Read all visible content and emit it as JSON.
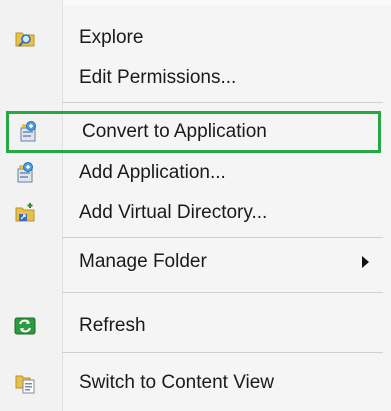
{
  "context_menu": {
    "items": [
      {
        "label": "Explore",
        "icon": "folder-search-icon"
      },
      {
        "label": "Edit Permissions...",
        "icon": ""
      },
      {
        "label": "Convert to Application",
        "icon": "convert-application-icon",
        "highlighted": true
      },
      {
        "label": "Add Application...",
        "icon": "add-application-icon"
      },
      {
        "label": "Add Virtual Directory...",
        "icon": "add-virtual-directory-icon"
      },
      {
        "label": "Manage Folder",
        "icon": "",
        "has_submenu": true
      },
      {
        "label": "Refresh",
        "icon": "refresh-icon"
      },
      {
        "label": "Switch to Content View",
        "icon": "content-view-icon"
      }
    ],
    "highlight_color": "#27a844"
  }
}
